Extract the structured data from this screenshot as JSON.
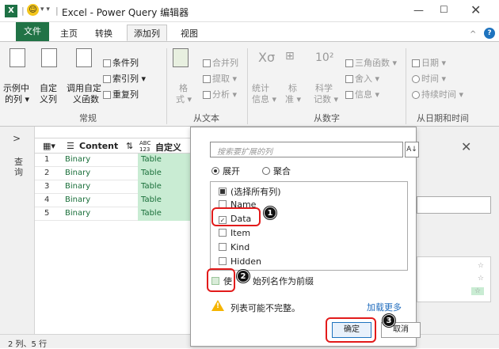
{
  "titlebar": {
    "excel_badge": "X",
    "qa_arrows": "▾ ▾",
    "title": "Excel - Power Query 编辑器",
    "min": "—",
    "max": "☐",
    "close": "✕"
  },
  "tabs": {
    "file": "文件",
    "home": "主页",
    "transform": "转换",
    "add_column": "添加列",
    "view": "视图",
    "collapse": "^",
    "help": "?"
  },
  "ribbon": {
    "example_col": [
      "示例中",
      "的列 ▾"
    ],
    "custom_col": [
      "自定",
      "义列"
    ],
    "invoke_custom": [
      "调用自定",
      "义函数"
    ],
    "conditional_col": "条件列",
    "index_col": "索引列 ▾",
    "duplicate_col": "重复列",
    "group_general": "常规",
    "format": [
      "格",
      "式 ▾"
    ],
    "merge_cols": "合并列",
    "extract": "提取 ▾",
    "parse": "分析 ▾",
    "group_text": "从文本",
    "statistics": [
      "统计",
      "信息 ▾"
    ],
    "standard": [
      "标",
      "准 ▾"
    ],
    "scientific": [
      "科学",
      "记数 ▾"
    ],
    "trig": "三角函数 ▾",
    "rounding": "舍入 ▾",
    "info": "信息 ▾",
    "group_number": "从数字",
    "date": "日期 ▾",
    "time": "时间 ▾",
    "duration": "持续时间 ▾",
    "group_datetime": "从日期和时间"
  },
  "queries": {
    "arrow": ">",
    "label": "查询"
  },
  "grid": {
    "columns": [
      "Content",
      "自定义"
    ],
    "col_type_icon": "ABC 123",
    "rows": [
      {
        "n": "1",
        "content": "Binary",
        "custom": "Table"
      },
      {
        "n": "2",
        "content": "Binary",
        "custom": "Table"
      },
      {
        "n": "3",
        "content": "Binary",
        "custom": "Table"
      },
      {
        "n": "4",
        "content": "Binary",
        "custom": "Table"
      },
      {
        "n": "5",
        "content": "Binary",
        "custom": "Table"
      }
    ]
  },
  "dialog": {
    "search_placeholder": "搜索要扩展的列",
    "sort_icon": "A↓",
    "expand": "展开",
    "aggregate": "聚合",
    "items": [
      {
        "label": "(选择所有列)",
        "state": "partial"
      },
      {
        "label": "Name",
        "state": "off"
      },
      {
        "label": "Data",
        "state": "on"
      },
      {
        "label": "Item",
        "state": "off"
      },
      {
        "label": "Kind",
        "state": "off"
      },
      {
        "label": "Hidden",
        "state": "off"
      }
    ],
    "prefix_left": "使",
    "prefix_right": "始列名作为前缀",
    "warning": "列表可能不完整。",
    "load_more": "加载更多",
    "ok": "确定",
    "cancel": "取消",
    "badges": [
      "1",
      "2",
      "3"
    ]
  },
  "right_panel": {
    "close": "✕",
    "stars": [
      "☆",
      "☆",
      "☆"
    ]
  },
  "status": "2 列、5 行",
  "colors": {
    "excel_green": "#217346",
    "annotation_red": "#e21b1b",
    "table_cell": "#c9ecd3",
    "link": "#1e6bbd"
  }
}
